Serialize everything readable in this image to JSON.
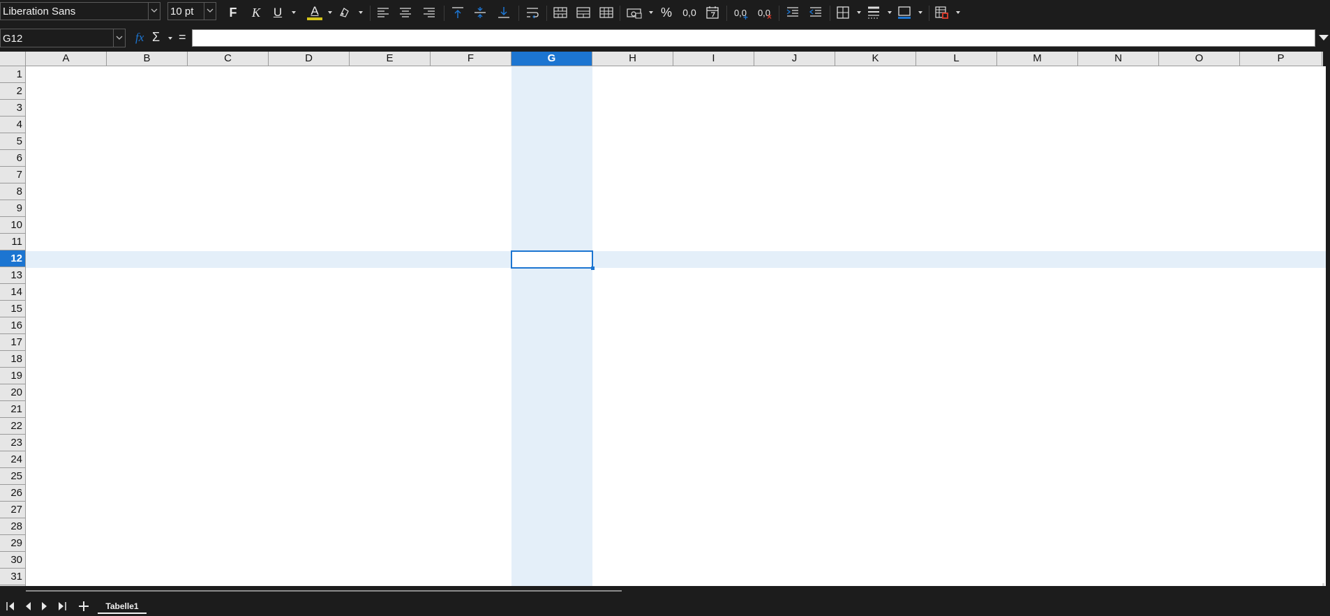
{
  "toolbar": {
    "font_name": "Liberation Sans",
    "font_size": "10 pt",
    "bold_label": "F",
    "italic_label": "K",
    "underline_label": "U",
    "font_color_label": "A",
    "percent_label": "%",
    "decimal_label": "0,0",
    "add_decimal_label": "0,0",
    "delete_decimal_label": "0,0",
    "accent_yellow": "#d4c41a",
    "accent_blue": "#1c75d1",
    "accent_red": "#d23b2c"
  },
  "formula_bar": {
    "name_box": "G12",
    "function_label": "fx",
    "sum_label": "Σ",
    "equals_label": "=",
    "formula_value": ""
  },
  "grid": {
    "columns": [
      "A",
      "B",
      "C",
      "D",
      "E",
      "F",
      "G",
      "H",
      "I",
      "J",
      "K",
      "L",
      "M",
      "N",
      "O",
      "P"
    ],
    "rows": [
      "1",
      "2",
      "3",
      "4",
      "5",
      "6",
      "7",
      "8",
      "9",
      "10",
      "11",
      "12",
      "13",
      "14",
      "15",
      "16",
      "17",
      "18",
      "19",
      "20",
      "21",
      "22",
      "23",
      "24",
      "25",
      "26",
      "27",
      "28",
      "29",
      "30",
      "31"
    ],
    "selected_column": "G",
    "selected_row": "12",
    "selection_color": "#1c75d1",
    "highlight_color": "#e4eff9"
  },
  "sheets": {
    "tabs": [
      "Tabelle1"
    ],
    "active": "Tabelle1"
  }
}
